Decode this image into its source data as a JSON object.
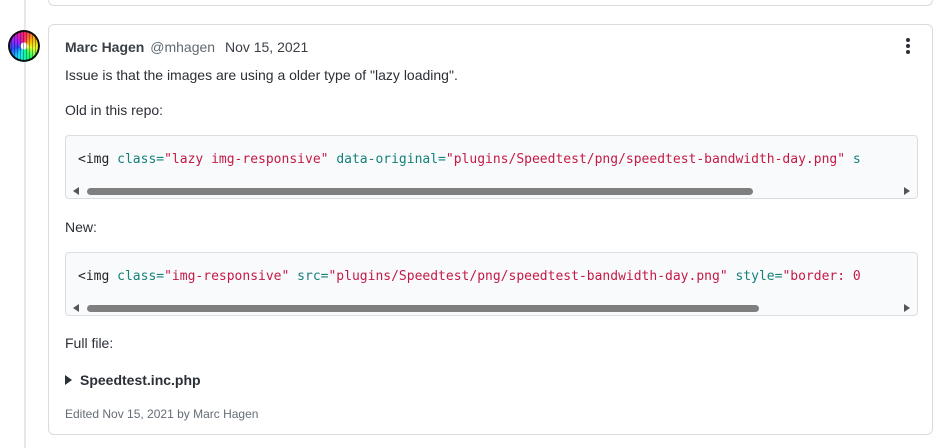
{
  "comment": {
    "author": "Marc Hagen",
    "handle": "@mhagen",
    "date": "Nov 15, 2021",
    "menu_icon": "kebab-menu-icon",
    "intro": "Issue is that the images are using a older type of \"lazy loading\".",
    "old_label": "Old in this repo:",
    "old_code": {
      "open": "<img",
      "class_attr": "class=",
      "class_val": "\"lazy img-responsive\"",
      "data_attr": "data-original=",
      "data_val": "\"plugins/Speedtest/png/speedtest-bandwidth-day.png\"",
      "tail": "s"
    },
    "new_label": "New:",
    "new_code": {
      "open": "<img",
      "class_attr": "class=",
      "class_val": "\"img-responsive\"",
      "src_attr": "src=",
      "src_val": "\"plugins/Speedtest/png/speedtest-bandwidth-day.png\"",
      "style_attr": "style=",
      "style_val": "\"border: 0"
    },
    "full_file_label": "Full file:",
    "details_summary": "Speedtest.inc.php",
    "edited": "Edited Nov 15, 2021 by Marc Hagen"
  },
  "colors": {
    "code_tag": "#1f2328",
    "code_attr": "#16807a",
    "code_string": "#c41a46",
    "card_border": "#d8dbe0"
  }
}
